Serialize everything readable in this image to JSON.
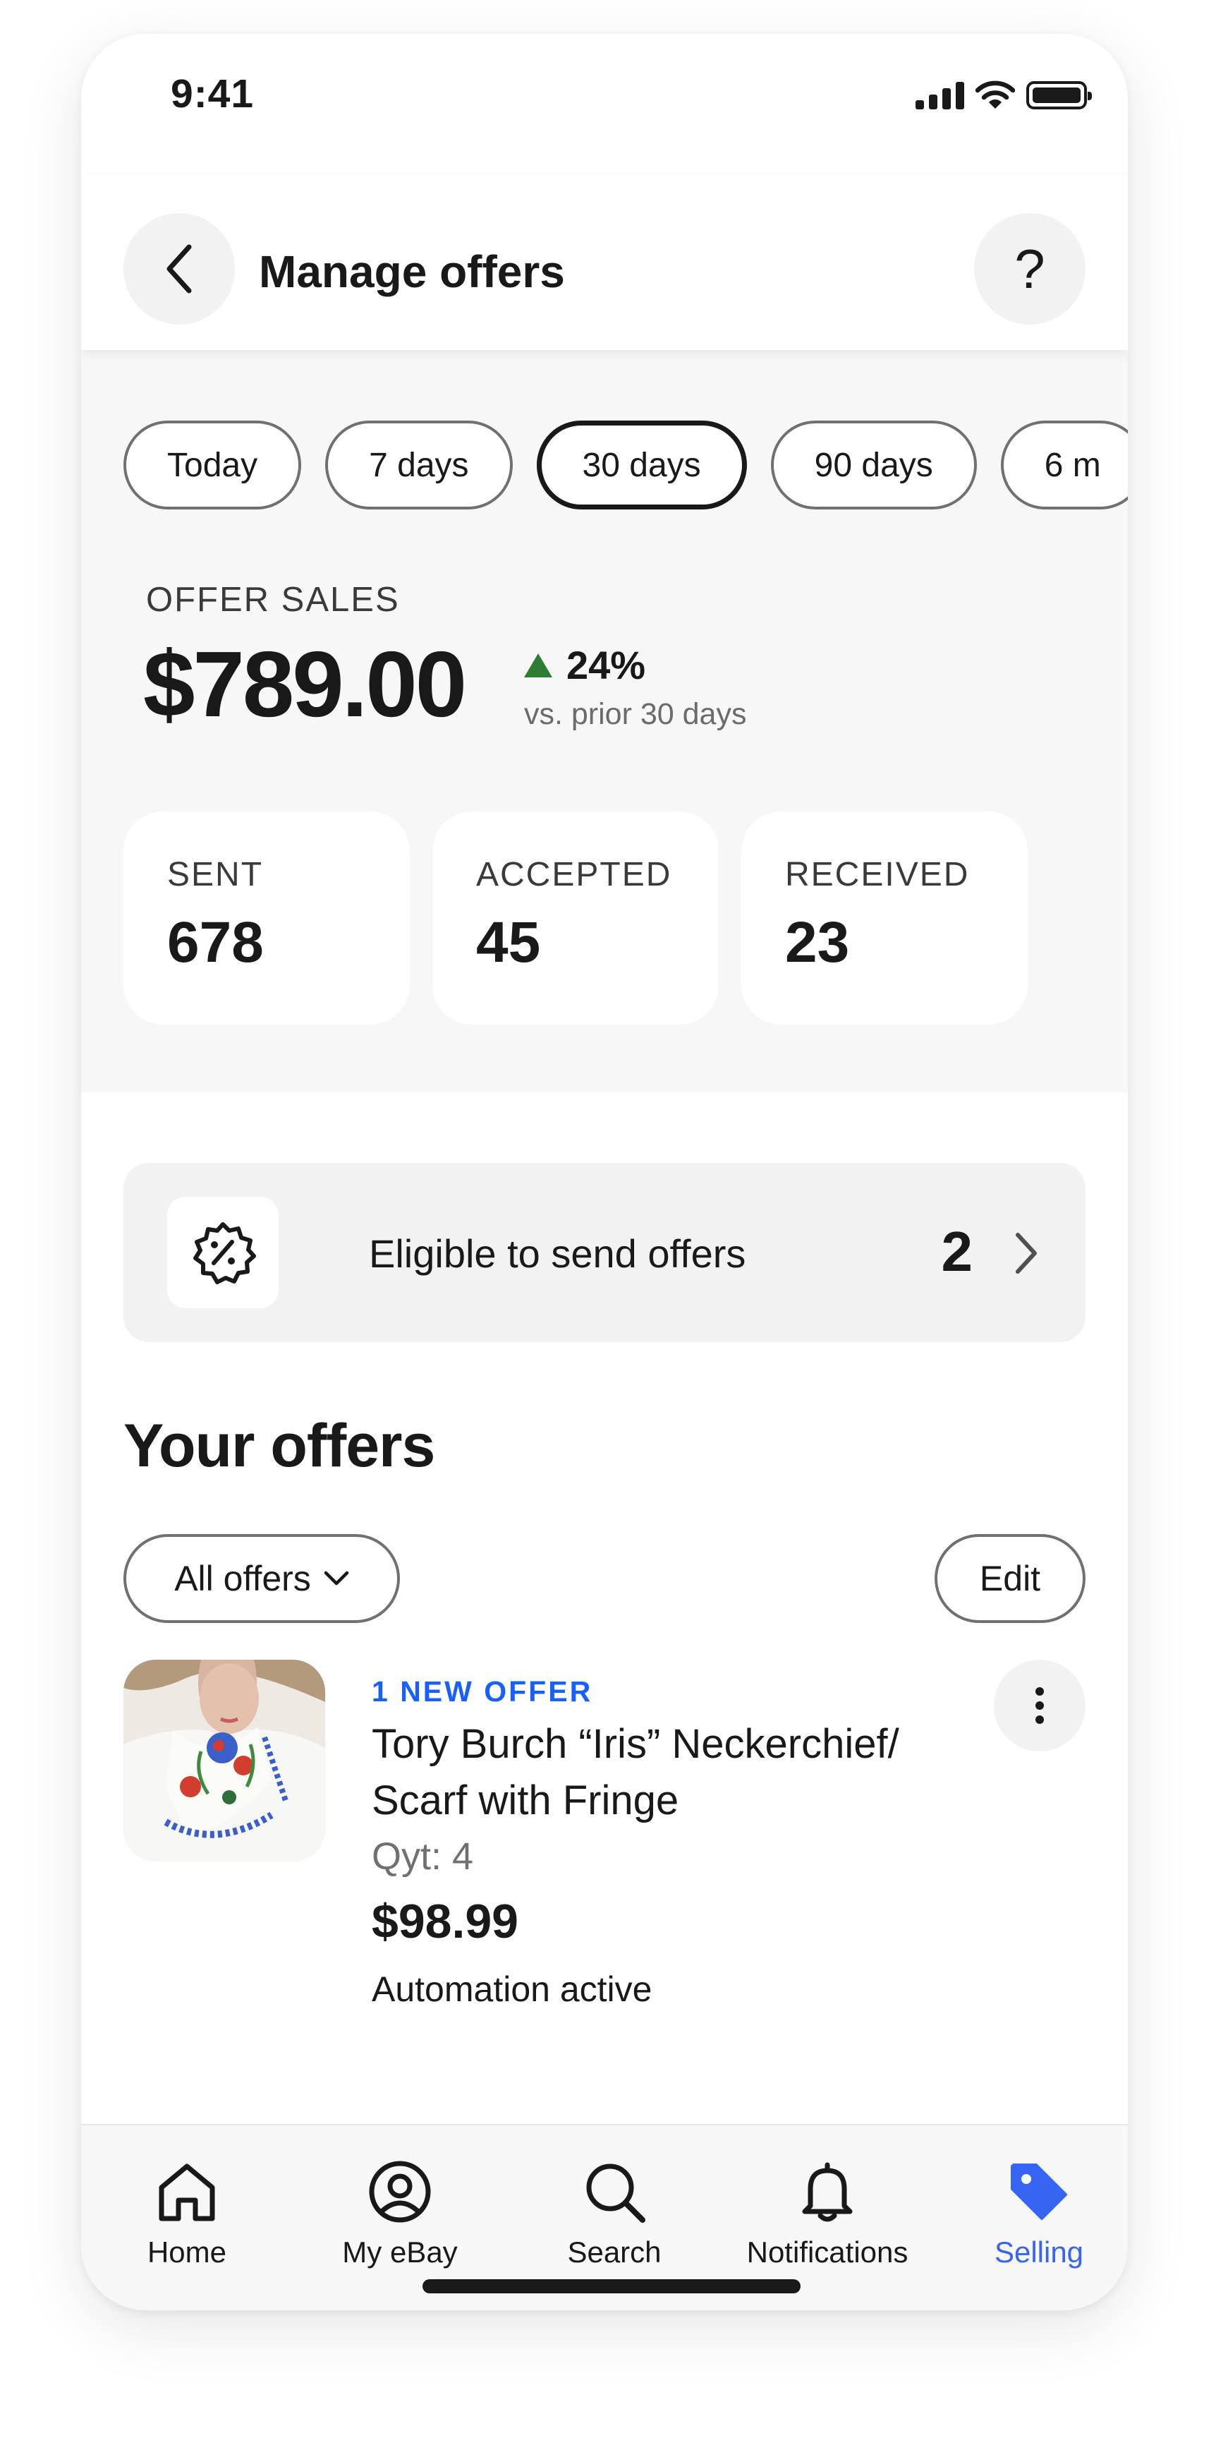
{
  "status_bar": {
    "time": "9:41"
  },
  "header": {
    "title": "Manage offers",
    "help_label": "?"
  },
  "date_filters": [
    {
      "label": "Today",
      "active": false
    },
    {
      "label": "7 days",
      "active": false
    },
    {
      "label": "30 days",
      "active": true
    },
    {
      "label": "90 days",
      "active": false
    },
    {
      "label": "6 m",
      "active": false
    }
  ],
  "offer_sales": {
    "label": "OFFER SALES",
    "value": "$789.00",
    "change": "24%",
    "change_direction": "up",
    "change_note": "vs. prior 30 days"
  },
  "stats": [
    {
      "label": "SENT",
      "value": "678"
    },
    {
      "label": "ACCEPTED",
      "value": "45"
    },
    {
      "label": "RECEIVED",
      "value": "23"
    }
  ],
  "eligible": {
    "label": "Eligible to send offers",
    "count": "2",
    "icon": "percent-badge-icon"
  },
  "offers_section": {
    "title": "Your offers",
    "filter_label": "All offers",
    "edit_label": "Edit"
  },
  "offer_item": {
    "badge": "1 NEW OFFER",
    "title": "Tory Burch “Iris” Neckerchief/ Scarf with Fringe",
    "quantity": "Qyt: 4",
    "price": "$98.99",
    "status": "Automation active"
  },
  "bottom_nav": [
    {
      "label": "Home",
      "icon": "home-icon",
      "active": false
    },
    {
      "label": "My eBay",
      "icon": "user-circle-icon",
      "active": false
    },
    {
      "label": "Search",
      "icon": "search-icon",
      "active": false
    },
    {
      "label": "Notifications",
      "icon": "bell-icon",
      "active": false
    },
    {
      "label": "Selling",
      "icon": "tag-icon",
      "active": true
    }
  ],
  "colors": {
    "accent_blue": "#3665f3",
    "badge_blue": "#1760ff",
    "positive_green": "#2e7d32",
    "text_primary": "#191919",
    "surface_gray": "#f7f7f7"
  }
}
